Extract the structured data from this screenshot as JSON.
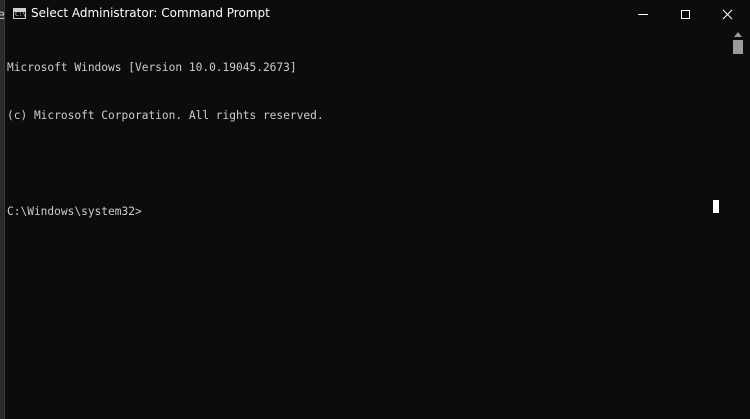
{
  "background_window": {
    "visible_char": "e"
  },
  "window": {
    "title": "Select Administrator: Command Prompt",
    "icon": "cmd-icon",
    "icon_text": "C:\\",
    "controls": {
      "minimize": "minimize-icon",
      "maximize": "maximize-icon",
      "close": "close-icon"
    }
  },
  "console": {
    "lines": [
      "Microsoft Windows [Version 10.0.19045.2673]",
      "(c) Microsoft Corporation. All rights reserved.",
      "",
      "C:\\Windows\\system32>"
    ]
  },
  "colors": {
    "background": "#0c0c0c",
    "text": "#cccccc",
    "title_text": "#ffffff",
    "scrollbar": "#9a9a9a"
  }
}
